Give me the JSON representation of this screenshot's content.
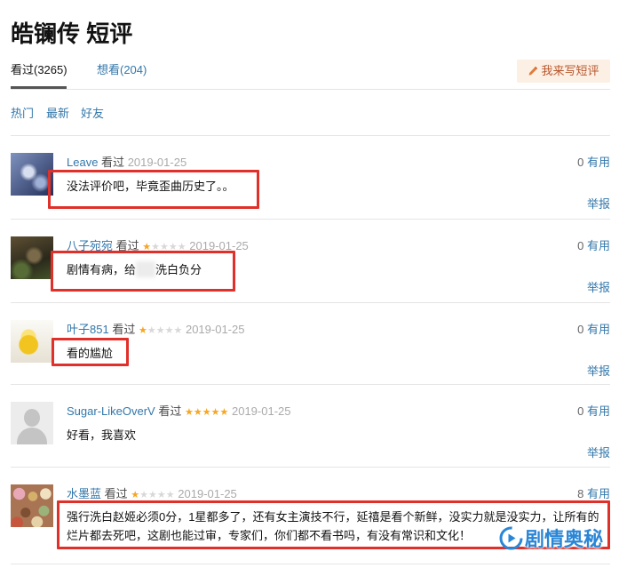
{
  "page": {
    "title": "皓镧传 短评"
  },
  "tabs": [
    {
      "label": "看过(3265)",
      "active": true
    },
    {
      "label": "想看(204)",
      "active": false
    }
  ],
  "write_button": {
    "label": "我来写短评",
    "icon": "pencil-icon"
  },
  "filters": [
    {
      "label": "热门"
    },
    {
      "label": "最新"
    },
    {
      "label": "好友"
    }
  ],
  "rating_max": 5,
  "comments": [
    {
      "user": "Leave",
      "status": "看过",
      "rating": null,
      "date": "2019-01-25",
      "useful_count": "0",
      "useful_label": "有用",
      "text": "没法评价吧，毕竟歪曲历史了。。",
      "report_label": "举报"
    },
    {
      "user": "八子宛宛",
      "status": "看过",
      "rating": 1,
      "date": "2019-01-25",
      "useful_count": "0",
      "useful_label": "有用",
      "text_before": "剧情有病，给",
      "text_after": "洗白负分",
      "report_label": "举报"
    },
    {
      "user": "叶子851",
      "status": "看过",
      "rating": 1,
      "date": "2019-01-25",
      "useful_count": "0",
      "useful_label": "有用",
      "text": "看的尴尬",
      "report_label": "举报"
    },
    {
      "user": "Sugar-LikeOverV",
      "status": "看过",
      "rating": 5,
      "date": "2019-01-25",
      "useful_count": "0",
      "useful_label": "有用",
      "text": "好看，我喜欢",
      "report_label": "举报",
      "avatar_icon": "default-avatar-icon"
    },
    {
      "user": "水墨蓝",
      "status": "看过",
      "rating": 1,
      "date": "2019-01-25",
      "useful_count": "8",
      "useful_label": "有用",
      "text": "强行洗白赵姬必须0分，1星都多了，还有女主演技不行，延禧是看个新鲜，没实力就是没实力，让所有的烂片都去死吧，这剧也能过审，专家们，你们都不看书吗，有没有常识和文化！"
    }
  ],
  "watermark": {
    "text": "剧情奥秘",
    "icon": "play-logo-icon"
  },
  "colors": {
    "link": "#3377aa",
    "star": "#f6a623",
    "highlight": "#e0302a",
    "watermark": "#2a86d6"
  }
}
